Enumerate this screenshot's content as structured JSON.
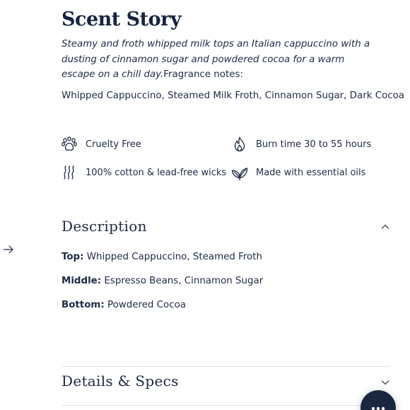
{
  "scent_story": {
    "title": "Scent Story",
    "description": "Steamy and froth whipped milk tops an Italian cappuccino with a dusting of cinnamon sugar and powdered cocoa for a warm escape on a chill day.",
    "fragrance_notes_label": "Fragrance notes:",
    "notes_list": "Whipped Cappuccino, Steamed Milk Froth, Cinnamon Sugar, Dark Cocoa"
  },
  "features": [
    {
      "label": "Cruelty Free",
      "icon": "paw-icon"
    },
    {
      "label": "Burn time 30 to 55 hours",
      "icon": "flame-icon"
    },
    {
      "label": "100% cotton & lead-free wicks",
      "icon": "wavy-lines-icon"
    },
    {
      "label": "Made with essential oils",
      "icon": "leaf-icon"
    }
  ],
  "description": {
    "title": "Description",
    "expanded": true,
    "rows": [
      {
        "key": "Top:",
        "value": "Whipped Cappuccino, Steamed Froth"
      },
      {
        "key": "Middle:",
        "value": "Espresso Beans, Cinnamon Sugar"
      },
      {
        "key": "Bottom:",
        "value": "Powdered Cocoa"
      }
    ]
  },
  "specs": {
    "title": "Details & Specs",
    "expanded": false
  },
  "colors": {
    "text": "#1e2a44",
    "chat_button": "#1b2640"
  }
}
